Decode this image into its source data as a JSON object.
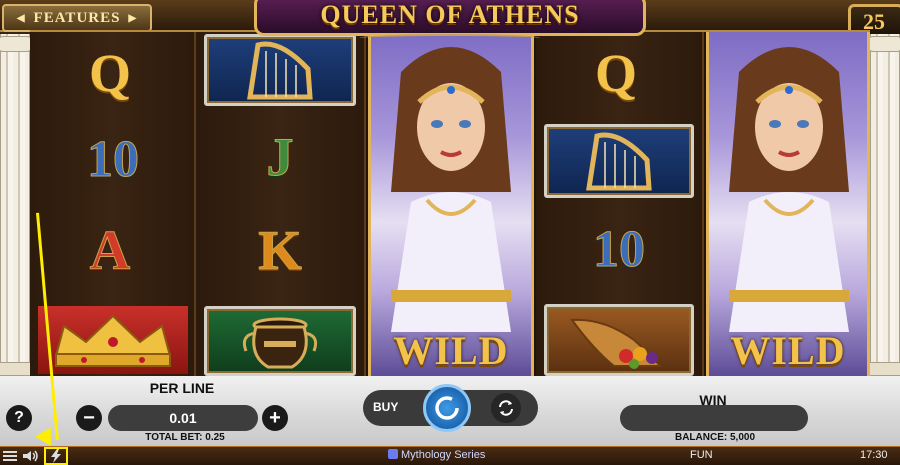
{
  "header": {
    "features_label": "FEATURES",
    "title": "QUEEN OF ATHENS",
    "lines": "25"
  },
  "reels": {
    "wild_label": "WILD",
    "symbols": {
      "r1": [
        "Q",
        "10",
        "A",
        "crown"
      ],
      "r2": [
        "harp",
        "J",
        "K",
        "amphora"
      ],
      "r3": [
        "wild"
      ],
      "r4": [
        "Q",
        "harp",
        "10",
        "cornucopia"
      ],
      "r5": [
        "wild"
      ]
    }
  },
  "controls": {
    "help_label": "?",
    "per_line_label": "PER LINE",
    "per_line_value": "0.01",
    "minus_label": "−",
    "plus_label": "+",
    "total_bet_label": "TOTAL BET: 0.25",
    "buy_label": "BUY",
    "win_label": "WIN",
    "win_value": "",
    "balance_label": "BALANCE: 5,000"
  },
  "footer": {
    "series_label": "Mythology Series",
    "mode": "FUN",
    "clock": "17:30"
  },
  "colors": {
    "gold": "#f3c24b",
    "blue_symbol": "#3b6db8",
    "green_symbol": "#3f8a3c",
    "red_symbol": "#d23a2a",
    "orange_symbol": "#e08a1c",
    "annotation": "#ffee00"
  }
}
